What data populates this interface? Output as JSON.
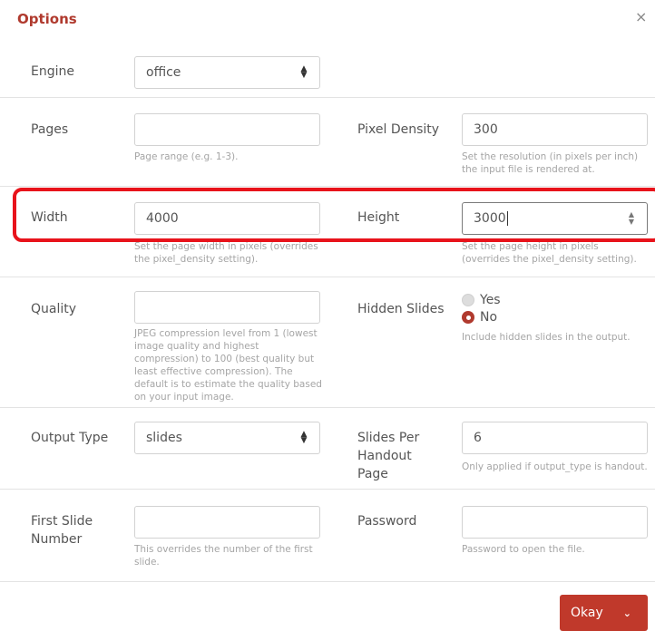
{
  "dialog": {
    "title": "Options",
    "close_glyph": "×"
  },
  "engine": {
    "label": "Engine",
    "value": "office"
  },
  "pages": {
    "label": "Pages",
    "value": "",
    "help": "Page range (e.g. 1-3)."
  },
  "pixel_density": {
    "label": "Pixel Density",
    "value": "300",
    "help": "Set the resolution (in pixels per inch) the input file is rendered at."
  },
  "width": {
    "label": "Width",
    "value": "4000",
    "help": "Set the page width in pixels (overrides the pixel_density setting)."
  },
  "height": {
    "label": "Height",
    "value": "3000",
    "help": "Set the page height in pixels (overrides the pixel_density setting)."
  },
  "quality": {
    "label": "Quality",
    "value": "",
    "help": "JPEG compression level from 1 (lowest image quality and highest compression) to 100 (best quality but least effective compression). The default is to estimate the quality based on your input image."
  },
  "hidden_slides": {
    "label": "Hidden Slides",
    "option_yes": "Yes",
    "option_no": "No",
    "selected": "No",
    "help": "Include hidden slides in the output."
  },
  "output_type": {
    "label": "Output Type",
    "value": "slides"
  },
  "slides_per_handout": {
    "label_line1": "Slides Per",
    "label_line2": "Handout",
    "label_line3": "Page",
    "value": "6",
    "help": "Only applied if output_type is handout."
  },
  "first_slide_number": {
    "label_line1": "First Slide",
    "label_line2": "Number",
    "value": "",
    "help": "This overrides the number of the first slide."
  },
  "password": {
    "label": "Password",
    "value": "",
    "help": "Password to open the file."
  },
  "footer": {
    "okay_label": "Okay"
  },
  "colors": {
    "accent": "#c0392b",
    "highlight": "#e8131b"
  }
}
